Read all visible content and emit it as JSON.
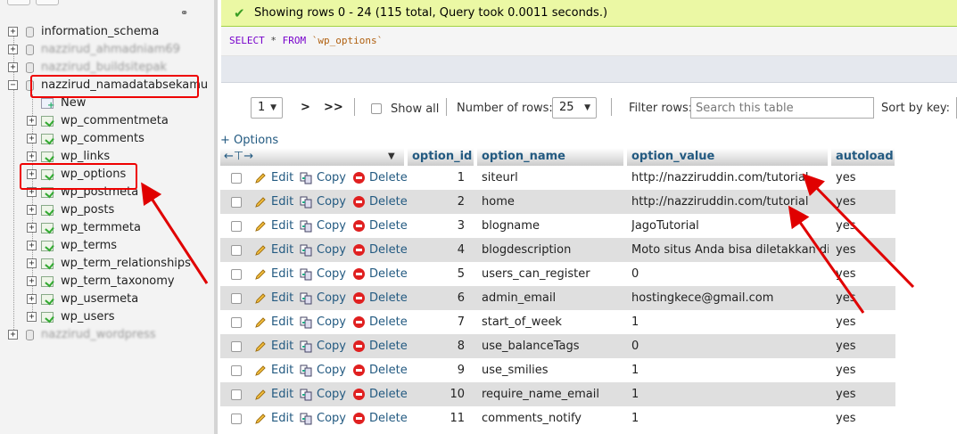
{
  "sidebar": {
    "databases_top": [
      {
        "label": "information_schema",
        "expander": "+",
        "blurred": false
      },
      {
        "label": "nazzirud_ahmadniam69",
        "expander": "+",
        "blurred": true
      },
      {
        "label": "nazzirud_buildsitepak",
        "expander": "+",
        "blurred": true
      }
    ],
    "active_db": {
      "label": "nazzirud_namadatabsekamu",
      "expander": "−"
    },
    "new_item": "New",
    "tables": [
      "wp_commentmeta",
      "wp_comments",
      "wp_links",
      "wp_options",
      "wp_postmeta",
      "wp_posts",
      "wp_termmeta",
      "wp_terms",
      "wp_term_relationships",
      "wp_term_taxonomy",
      "wp_usermeta",
      "wp_users"
    ],
    "table_expander": "+",
    "database_bottom": {
      "label": "nazzirud_wordpress",
      "expander": "+",
      "blurred": true
    }
  },
  "result": {
    "success_message": "Showing rows 0 - 24 (115 total, Query took 0.0011 seconds.)",
    "sql": {
      "select": "SELECT",
      "mid": " * ",
      "from": "FROM",
      "table": "`wp_options`"
    }
  },
  "navigation": {
    "page": "1",
    "next": ">",
    "last": ">>",
    "show_all_label": "Show all",
    "rows_label": "Number of rows:",
    "rows_value": "25",
    "filter_label": "Filter rows:",
    "filter_placeholder": "Search this table",
    "sort_label": "Sort by key:"
  },
  "options_link": "+ Options",
  "columns": [
    "option_id",
    "option_name",
    "option_value",
    "autoload"
  ],
  "actions": {
    "edit": "Edit",
    "copy": "Copy",
    "delete": "Delete"
  },
  "rows": [
    {
      "option_id": "1",
      "option_name": "siteurl",
      "option_value": "http://nazziruddin.com/tutorial",
      "autoload": "yes"
    },
    {
      "option_id": "2",
      "option_name": "home",
      "option_value": "http://nazziruddin.com/tutorial",
      "autoload": "yes"
    },
    {
      "option_id": "3",
      "option_name": "blogname",
      "option_value": "JagoTutorial",
      "autoload": "yes"
    },
    {
      "option_id": "4",
      "option_name": "blogdescription",
      "option_value": "Moto situs Anda bisa diletakkan di sini",
      "autoload": "yes"
    },
    {
      "option_id": "5",
      "option_name": "users_can_register",
      "option_value": "0",
      "autoload": "yes"
    },
    {
      "option_id": "6",
      "option_name": "admin_email",
      "option_value": "hostingkece@gmail.com",
      "autoload": "yes"
    },
    {
      "option_id": "7",
      "option_name": "start_of_week",
      "option_value": "1",
      "autoload": "yes"
    },
    {
      "option_id": "8",
      "option_name": "use_balanceTags",
      "option_value": "0",
      "autoload": "yes"
    },
    {
      "option_id": "9",
      "option_name": "use_smilies",
      "option_value": "1",
      "autoload": "yes"
    },
    {
      "option_id": "10",
      "option_name": "require_name_email",
      "option_value": "1",
      "autoload": "yes"
    },
    {
      "option_id": "11",
      "option_name": "comments_notify",
      "option_value": "1",
      "autoload": "yes"
    }
  ],
  "colors": {
    "accent_link": "#235a81",
    "success_bg": "#ebf8a4",
    "annotation_red": "#e00000"
  }
}
